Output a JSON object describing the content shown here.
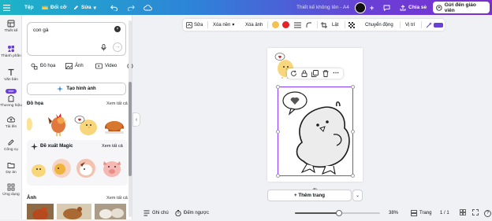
{
  "topbar": {
    "file_label": "Tệp",
    "magic_label": "Đổi cỡ",
    "edit_label": "Sửa",
    "doc_title": "Thiết kế không tên - A4",
    "share_label": "Chia sẻ",
    "send_label": "Gửi đến giáo viên"
  },
  "leftnav": [
    {
      "label": "Thiết kế",
      "icon": "layout-icon"
    },
    {
      "label": "Thành phần",
      "icon": "shapes-icon"
    },
    {
      "label": "Văn bản",
      "icon": "text-icon"
    },
    {
      "label": "Thương hiệu",
      "icon": "brand-icon",
      "badge": "Mới"
    },
    {
      "label": "Tải lên",
      "icon": "upload-icon"
    },
    {
      "label": "Công cụ",
      "icon": "pen-icon"
    },
    {
      "label": "Dự án",
      "icon": "folder-icon"
    },
    {
      "label": "Ứng dụng",
      "icon": "apps-icon"
    }
  ],
  "panel": {
    "search_value": "con gà",
    "chips": [
      "Đồ họa",
      "Ảnh",
      "Video"
    ],
    "generate_label": "Tạo hình ảnh",
    "section_graphics": "Đồ họa",
    "section_magic": "Đề xuất Magic",
    "section_photos": "Ảnh",
    "see_all": "Xem tất cả"
  },
  "toolbar": {
    "edit": "Sửa",
    "remove_bg": "Xóa nền",
    "erase": "Xóa ảnh",
    "arrange": "Lật",
    "animate": "Chuyển động",
    "position": "Vị trí",
    "color_yellow": "#f2c14e",
    "color_red": "#e0242b"
  },
  "canvas": {
    "add_page": "+ Thêm trang"
  },
  "bottombar": {
    "notes": "Ghi chú",
    "timer": "Đếm ngược",
    "zoom": "38%",
    "pages_label": "Trang",
    "page_count": "1 / 1"
  }
}
